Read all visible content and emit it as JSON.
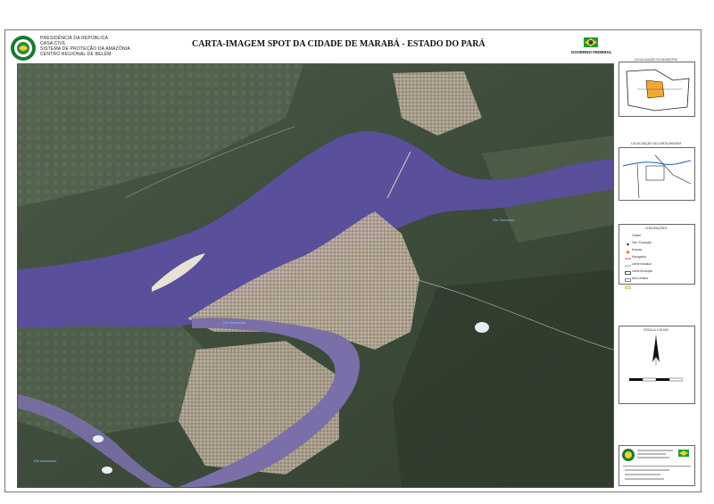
{
  "header": {
    "org_lines": [
      "PRESIDÊNCIA DA REPÚBLICA",
      "CASA CIVIL",
      "SISTEMA DE PROTEÇÃO DA AMAZÔNIA",
      "CENTRO REGIONAL DE BELÉM"
    ],
    "title": "CARTA-IMAGEM SPOT DA CIDADE DE MARABÁ - ESTADO DO PARÁ",
    "gov_label": "GOVERNO FEDERAL"
  },
  "map": {
    "river_labels": [
      "Rio Tocantins",
      "Rio Itacaiúnas",
      "Rio Itacaiúnas"
    ],
    "colors": {
      "river": "#5a4f9a",
      "vegetation": "#3b4a3a",
      "urban": "#b9a894",
      "accent_brand": "#1a7a2e"
    }
  },
  "side_panel": {
    "locator_title": "LOCALIZAÇÃO DO MUNICÍPIO",
    "inset_title": "LOCALIZAÇÃO DA CARTA-IMAGEM",
    "legend_title": "CONVENÇÕES",
    "legend_items": [
      "Cidade",
      "Vila / Povoação",
      "Estrada",
      "Hidrografia",
      "Limite Estadual",
      "Limite Municipal",
      "Área Urbana"
    ],
    "scale_title": "ESCALA 1:25.000"
  }
}
